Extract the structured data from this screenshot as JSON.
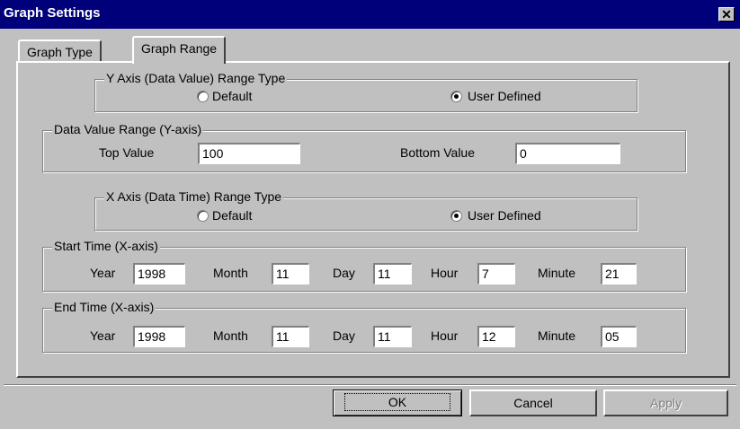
{
  "window": {
    "title": "Graph Settings",
    "close_glyph": "✕"
  },
  "tabs": [
    {
      "label": "Graph Type"
    },
    {
      "label": "Graph Range"
    }
  ],
  "y_range_type": {
    "legend": "Y Axis (Data Value) Range Type",
    "default_label": "Default",
    "user_label": "User Defined",
    "selected": "User Defined"
  },
  "data_value_range": {
    "legend": "Data Value Range (Y-axis)",
    "top_label": "Top Value",
    "top_value": "100",
    "bottom_label": "Bottom Value",
    "bottom_value": "0"
  },
  "x_range_type": {
    "legend": "X Axis (Data Time) Range Type",
    "default_label": "Default",
    "user_label": "User Defined",
    "selected": "User Defined"
  },
  "start_time": {
    "legend": "Start Time (X-axis)",
    "year_label": "Year",
    "year": "1998",
    "month_label": "Month",
    "month": "11",
    "day_label": "Day",
    "day": "11",
    "hour_label": "Hour",
    "hour": "7",
    "minute_label": "Minute",
    "minute": "21"
  },
  "end_time": {
    "legend": "End Time (X-axis)",
    "year_label": "Year",
    "year": "1998",
    "month_label": "Month",
    "month": "11",
    "day_label": "Day",
    "day": "11",
    "hour_label": "Hour",
    "hour": "12",
    "minute_label": "Minute",
    "minute": "05"
  },
  "buttons": {
    "ok": "OK",
    "cancel": "Cancel",
    "apply": "Apply"
  }
}
